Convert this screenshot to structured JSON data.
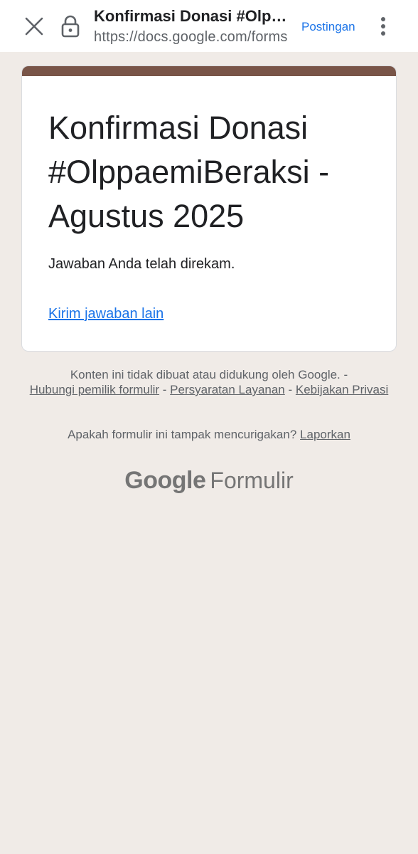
{
  "browser": {
    "page_title": "Konfirmasi Donasi #Olppaemi…",
    "url": "https://docs.google.com/forms",
    "postingan_label": "Postingan"
  },
  "form": {
    "title": "Konfirmasi Donasi #OlppaemiBeraksi - Agustus 2025",
    "response_message": "Jawaban Anda telah direkam.",
    "resubmit_link": "Kirim jawaban lain",
    "accent_color": "#795548"
  },
  "footer": {
    "disclaimer": "Konten ini tidak dibuat atau didukung oleh Google.",
    "sep1": " - ",
    "contact_owner": "Hubungi pemilik formulir",
    "sep2": " - ",
    "terms": "Persyaratan Layanan",
    "sep3": " - ",
    "privacy": "Kebijakan Privasi",
    "report_question": "Apakah formulir ini tampak mencurigakan?",
    "report_link": "Laporkan",
    "brand_google": "Google",
    "brand_product": "Formulir"
  },
  "icons": {
    "close": "close-icon",
    "lock": "lock-icon",
    "more": "more-vert-icon"
  },
  "colors": {
    "link_blue": "#1a73e8",
    "page_background": "#f0ebe7"
  }
}
